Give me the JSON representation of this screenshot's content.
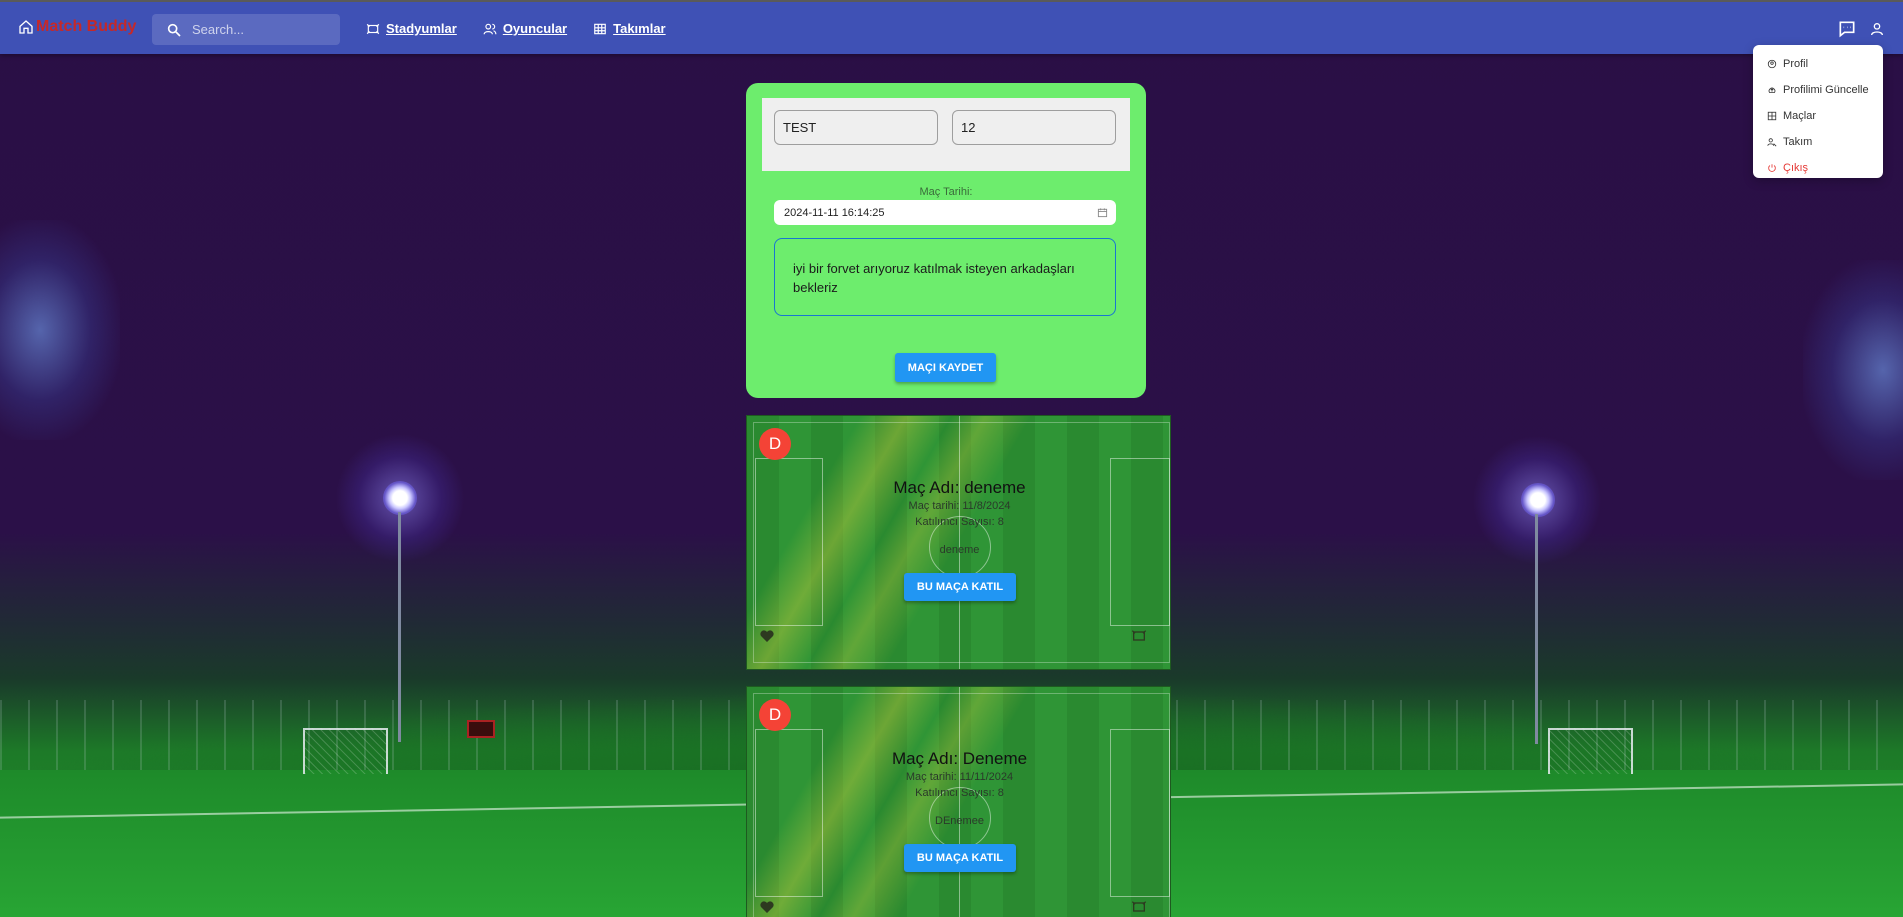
{
  "nav": {
    "brand": "Match Buddy",
    "search_placeholder": "Search...",
    "links": [
      {
        "label": "Stadyumlar",
        "icon": "stadium-icon"
      },
      {
        "label": "Oyuncular",
        "icon": "players-icon"
      },
      {
        "label": "Takımlar",
        "icon": "table-icon"
      }
    ],
    "right_icons": [
      "chat-icon",
      "user-icon"
    ]
  },
  "dropdown": {
    "items": [
      {
        "label": "Profil",
        "icon": "profile-icon"
      },
      {
        "label": "Profilimi Güncelle",
        "icon": "update-icon"
      },
      {
        "label": "Maçlar",
        "icon": "matches-icon"
      },
      {
        "label": "Takım",
        "icon": "team-icon"
      },
      {
        "label": "Çıkış",
        "icon": "logout-icon"
      }
    ],
    "logout_color": "#e53935"
  },
  "form": {
    "match_name": "TEST",
    "participant_count": "12",
    "date_label": "Maç Tarihi:",
    "date_value": "2024-11-11 16:14:25",
    "description": "iyi bir forvet arıyoruz katılmak isteyen arkadaşları bekleriz",
    "save_label": "MAÇI KAYDET"
  },
  "matches": [
    {
      "avatar": "D",
      "title": "Maç Adı: deneme",
      "date": "Maç tarihi: 11/8/2024",
      "participants": "Katılımcı Sayısı: 8",
      "description": "deneme",
      "join_label": "BU MAÇA KATIL"
    },
    {
      "avatar": "D",
      "title": "Maç Adı: Deneme",
      "date": "Maç tarihi: 11/11/2024",
      "participants": "Katılımcı Sayısı: 8",
      "description": "DEnemee",
      "join_label": "BU MAÇA KATIL"
    }
  ],
  "colors": {
    "navbar": "#3f51b5",
    "brand": "#c62828",
    "form_card": "#6ded6d",
    "button": "#2196f3",
    "avatar": "#f44336"
  }
}
